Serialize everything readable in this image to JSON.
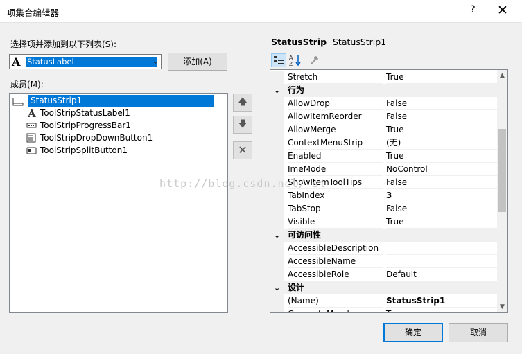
{
  "window": {
    "title": "项集合编辑器",
    "help": "?",
    "close": "✕"
  },
  "left": {
    "select_label": "选择项并添加到以下列表(S):",
    "combo_value": "StatusLabel",
    "add_button": "添加(A)",
    "members_label": "成员(M):",
    "members": [
      {
        "label": "StatusStrip1",
        "icon": "statusstrip-icon",
        "selected": true
      },
      {
        "label": "ToolStripStatusLabel1",
        "icon": "label-icon"
      },
      {
        "label": "ToolStripProgressBar1",
        "icon": "progressbar-icon"
      },
      {
        "label": "ToolStripDropDownButton1",
        "icon": "dropdown-button-icon"
      },
      {
        "label": "ToolStripSplitButton1",
        "icon": "split-button-icon"
      }
    ]
  },
  "properties": {
    "object_type": "StatusStrip",
    "object_name": "StatusStrip1",
    "rows": [
      {
        "name": "Stretch",
        "value": "True"
      },
      {
        "category": "行为"
      },
      {
        "name": "AllowDrop",
        "value": "False"
      },
      {
        "name": "AllowItemReorder",
        "value": "False"
      },
      {
        "name": "AllowMerge",
        "value": "True"
      },
      {
        "name": "ContextMenuStrip",
        "value": "(无)"
      },
      {
        "name": "Enabled",
        "value": "True"
      },
      {
        "name": "ImeMode",
        "value": "NoControl"
      },
      {
        "name": "ShowItemToolTips",
        "value": "False"
      },
      {
        "name": "TabIndex",
        "value": "3",
        "bold": true
      },
      {
        "name": "TabStop",
        "value": "False"
      },
      {
        "name": "Visible",
        "value": "True"
      },
      {
        "category": "可访问性"
      },
      {
        "name": "AccessibleDescription",
        "value": ""
      },
      {
        "name": "AccessibleName",
        "value": ""
      },
      {
        "name": "AccessibleRole",
        "value": "Default"
      },
      {
        "category": "设计"
      },
      {
        "name": "(Name)",
        "value": "StatusStrip1",
        "bold": true
      },
      {
        "name": "GenerateMember",
        "value": "True"
      }
    ]
  },
  "buttons": {
    "ok": "确定",
    "cancel": "取消"
  },
  "watermark": "http://blog.csdn.net/          st",
  "colors": {
    "selection": "#0078d7",
    "category_bg": "#f0f0f0"
  }
}
